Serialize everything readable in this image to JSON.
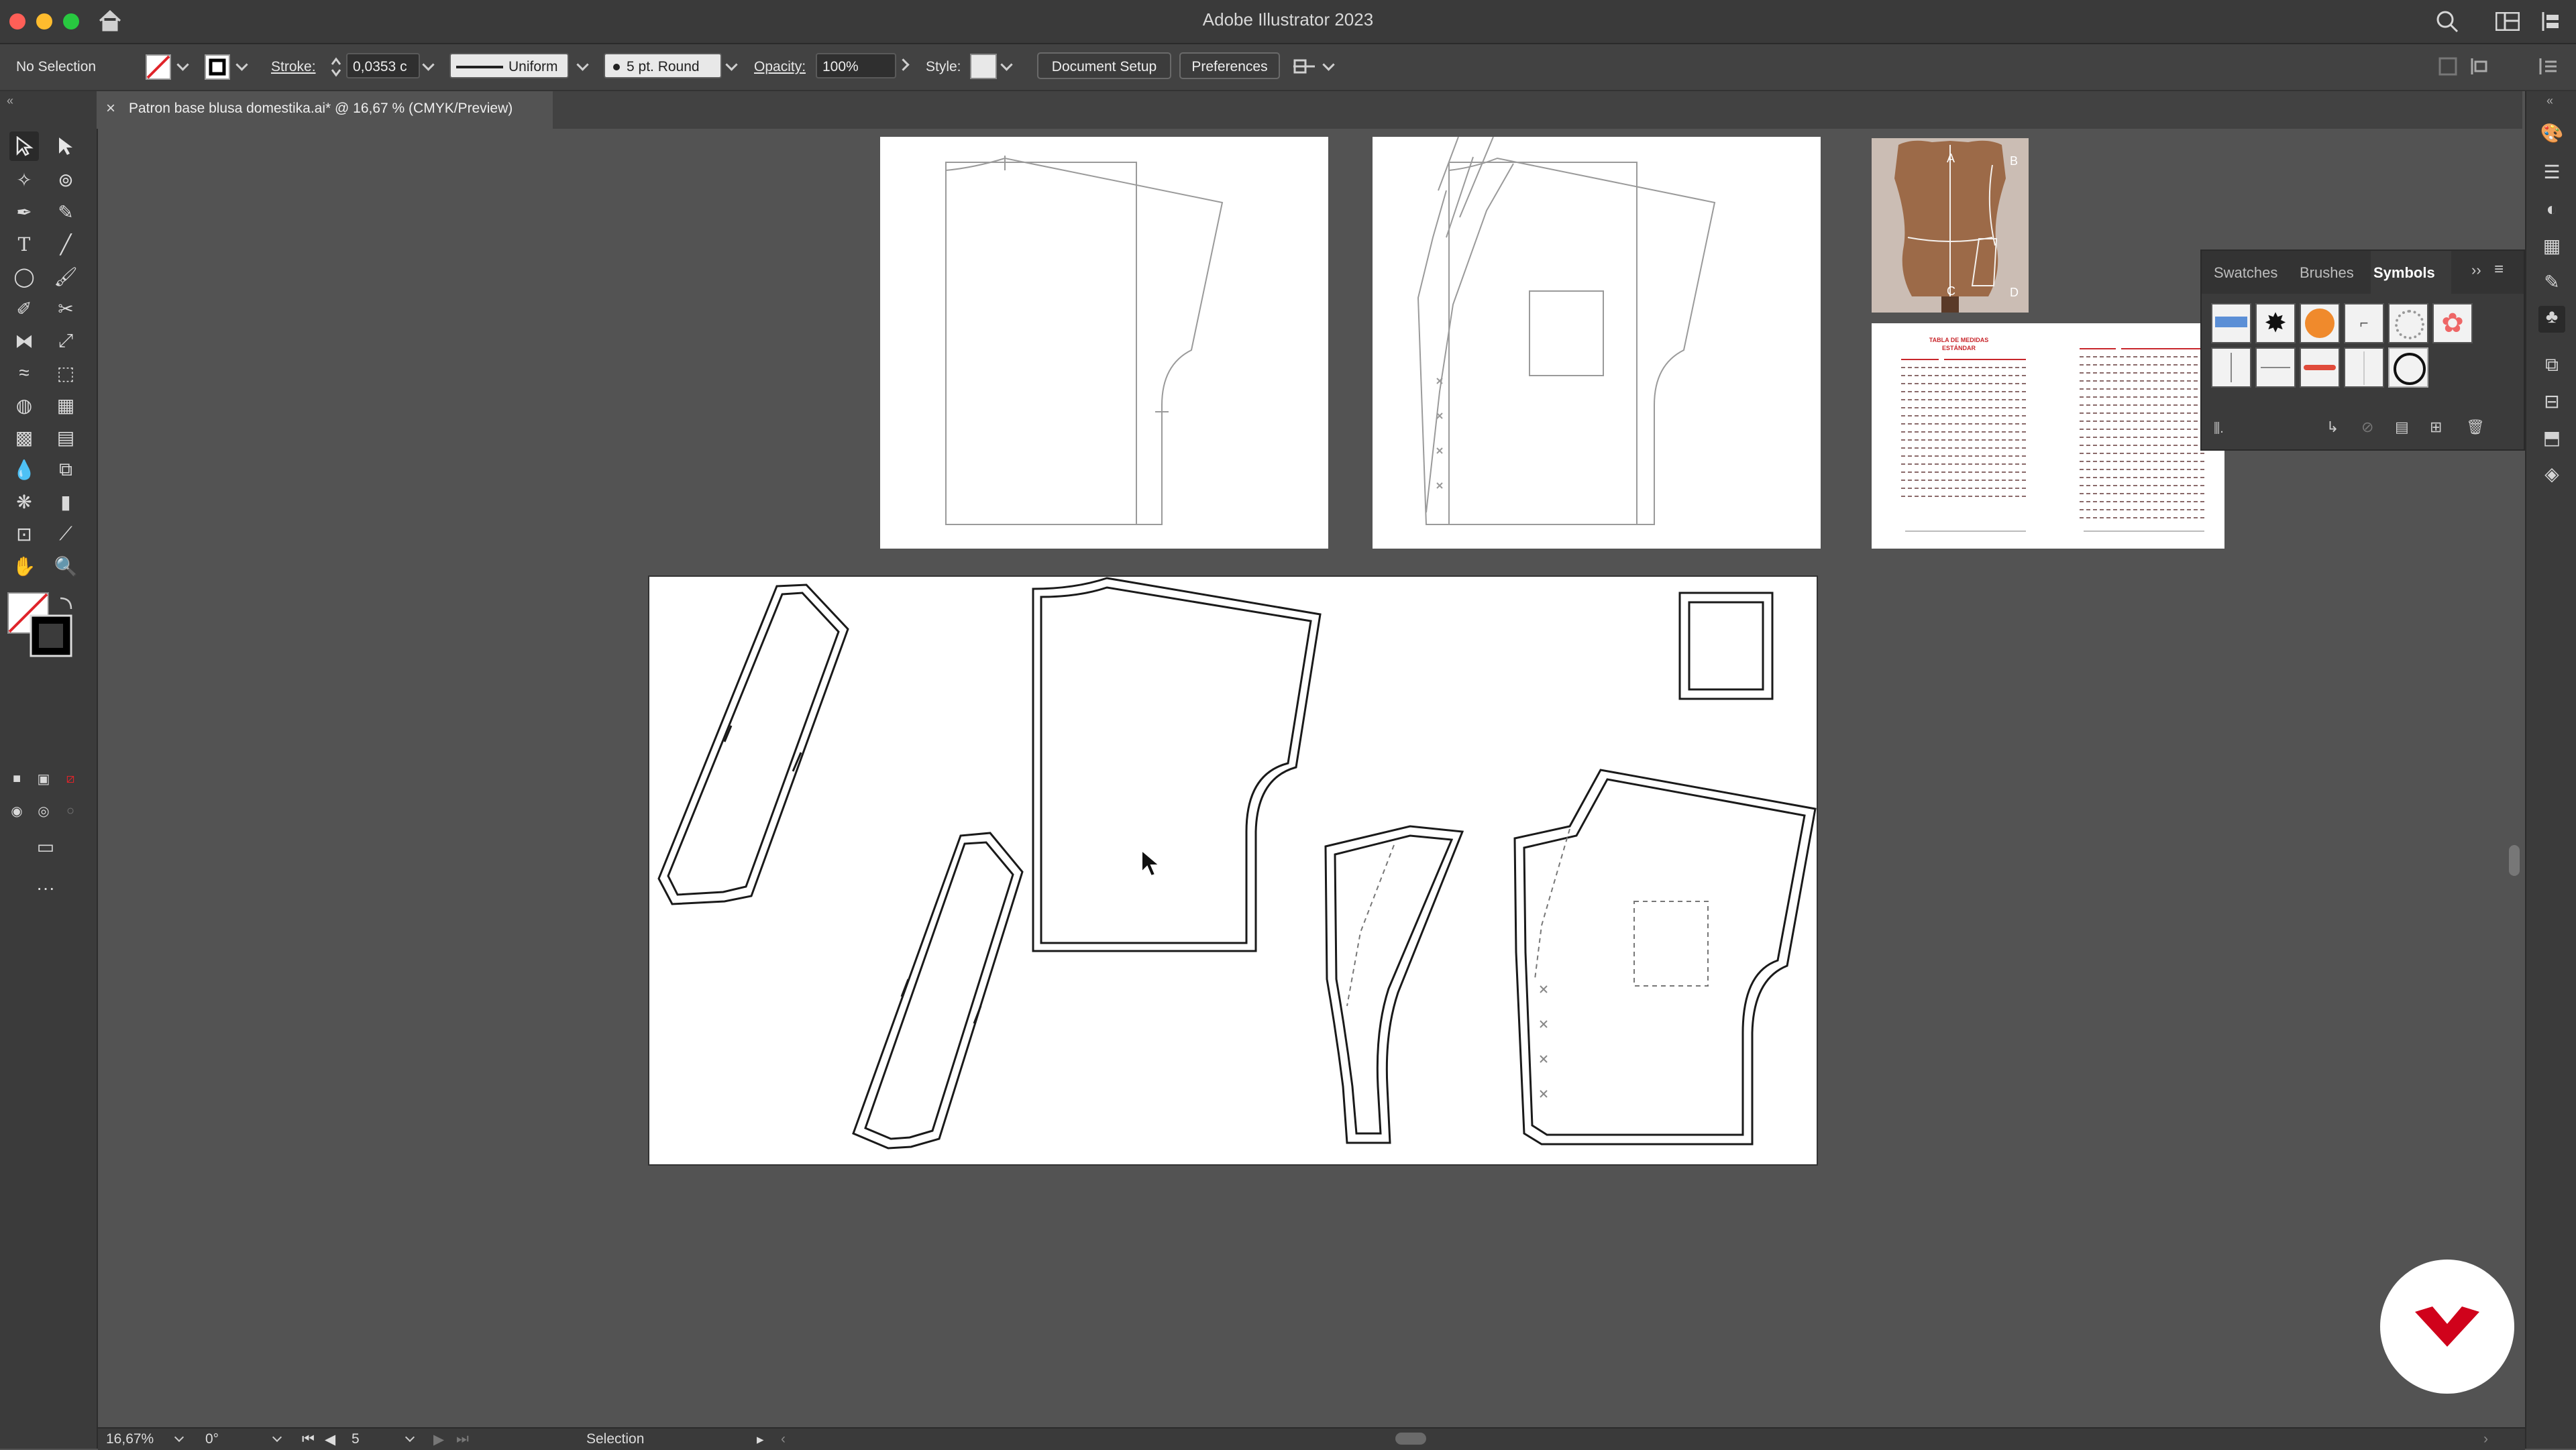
{
  "window": {
    "title": "Adobe Illustrator 2023"
  },
  "control_bar": {
    "selection": "No Selection",
    "stroke_label": "Stroke:",
    "stroke_value": "0,0353 c",
    "profile": "Uniform",
    "brush": "5 pt. Round",
    "opacity_label": "Opacity:",
    "opacity_value": "100%",
    "style_label": "Style:",
    "document_setup": "Document Setup",
    "preferences": "Preferences"
  },
  "document_tab": {
    "title": "Patron base blusa domestika.ai* @ 16,67 % (CMYK/Preview)"
  },
  "symbols_panel": {
    "tabs": [
      "Swatches",
      "Brushes",
      "Symbols"
    ],
    "active_tab": "Symbols"
  },
  "measure_sheet": {
    "title": "TABLA DE MEDIDAS",
    "subtitle": "ESTÁNDAR"
  },
  "mannequin_labels": [
    "A",
    "B",
    "C",
    "D"
  ],
  "status_bar": {
    "zoom": "16,67%",
    "rotation": "0°",
    "artboard_number": "5",
    "tool": "Selection"
  },
  "colors": {
    "accent_logo": "#d0021b",
    "ui_dark": "#3b3b3b",
    "canvas": "#535353"
  },
  "icons": [
    "home-icon",
    "search-icon",
    "workspace-icon",
    "arrange-icon",
    "selection-tool-icon",
    "direct-selection-tool-icon",
    "pen-tool-icon",
    "type-tool-icon",
    "hand-tool-icon",
    "zoom-tool-icon",
    "domestika-logo-icon"
  ]
}
